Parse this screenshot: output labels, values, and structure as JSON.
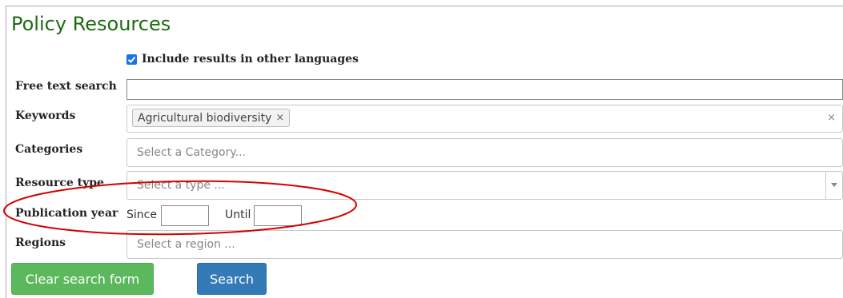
{
  "page": {
    "title": "Policy Resources"
  },
  "options": {
    "include_other_languages_label": "Include results in other languages",
    "include_other_languages_checked": true
  },
  "form": {
    "free_text": {
      "label": "Free text search",
      "value": ""
    },
    "keywords": {
      "label": "Keywords",
      "tags": [
        "Agricultural biodiversity"
      ],
      "tag_remove": "×",
      "clear": "×"
    },
    "categories": {
      "label": "Categories",
      "placeholder": "Select a Category..."
    },
    "resource_type": {
      "label": "Resource type",
      "placeholder": "Select a type ..."
    },
    "publication_year": {
      "label": "Publication year",
      "since_label": "Since",
      "until_label": "Until",
      "since_value": "",
      "until_value": ""
    },
    "regions": {
      "label": "Regions",
      "placeholder": "Select a region ..."
    }
  },
  "buttons": {
    "clear": "Clear search form",
    "search": "Search"
  },
  "colors": {
    "title": "#1e6b14",
    "clear_button": "#5cb85c",
    "search_button": "#337ab7",
    "annotation_ellipse": "#d40000"
  },
  "icons": {
    "checkbox": "checkmark-icon",
    "tag_remove": "close-icon",
    "clear": "close-icon",
    "dropdown": "chevron-down-icon"
  }
}
